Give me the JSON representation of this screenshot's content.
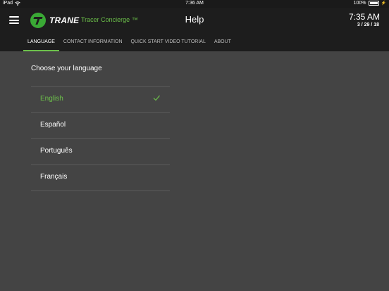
{
  "status_bar": {
    "device": "iPad",
    "time": "7:36 AM",
    "battery": "100%"
  },
  "header": {
    "brand": "TRANE",
    "app_name": "Tracer Concierge ™",
    "title": "Help",
    "time": "7:35 AM",
    "date": "3 / 29 / 18"
  },
  "tabs": [
    {
      "label": "LANGUAGE",
      "active": true
    },
    {
      "label": "CONTACT INFORMATION",
      "active": false
    },
    {
      "label": "QUICK START VIDEO TUTORIAL",
      "active": false
    },
    {
      "label": "ABOUT",
      "active": false
    }
  ],
  "language": {
    "heading": "Choose your language",
    "options": [
      {
        "label": "English",
        "selected": true
      },
      {
        "label": "Español",
        "selected": false
      },
      {
        "label": "Português",
        "selected": false
      },
      {
        "label": "Français",
        "selected": false
      }
    ]
  },
  "colors": {
    "accent": "#6cc04a",
    "header_bg": "#1d1d1d",
    "content_bg": "#444444"
  },
  "icons": [
    "wifi-icon",
    "battery-icon",
    "charging-icon",
    "hamburger-menu-icon",
    "trane-logo-icon",
    "checkmark-icon"
  ]
}
